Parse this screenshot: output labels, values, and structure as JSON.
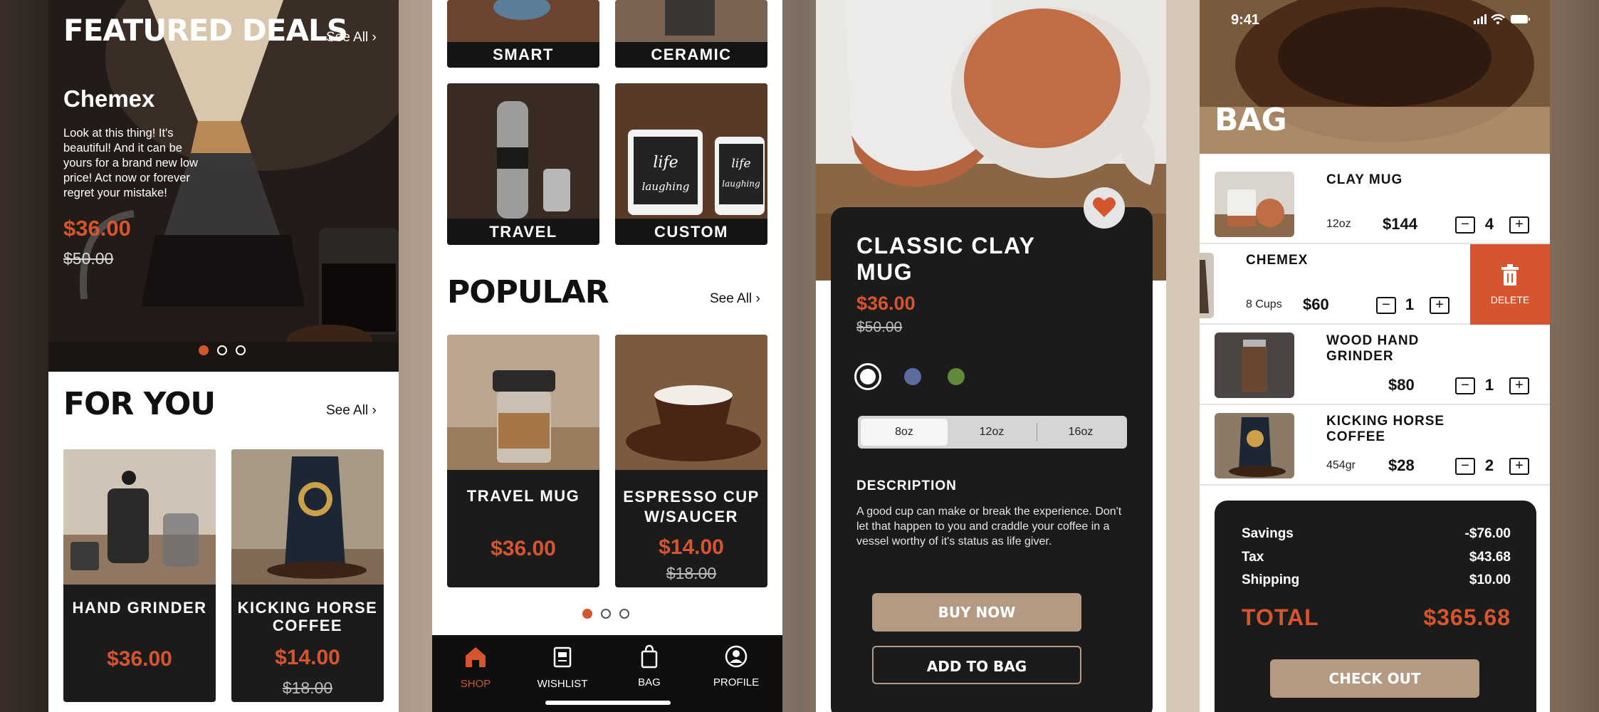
{
  "shop": {
    "featured_title": "FEATURED DEALS",
    "see_all": "See All",
    "hero": {
      "name": "Chemex",
      "description": "Look at this thing! It's beautiful! And it can be yours for a brand new low price! Act now or forever regret your mistake!",
      "price": "$36.00",
      "old_price": "$50.00"
    },
    "for_you_title": "FOR YOU",
    "for_you": [
      {
        "name": "HAND GRINDER",
        "price": "$36.00",
        "old_price": ""
      },
      {
        "name": "KICKING HORSE COFFEE",
        "price": "$14.00",
        "old_price": "$18.00"
      }
    ]
  },
  "categories": {
    "items": [
      "SMART",
      "CERAMIC",
      "TRAVEL",
      "CUSTOM"
    ],
    "popular_title": "POPULAR",
    "see_all": "See All",
    "popular": [
      {
        "name": "TRAVEL MUG",
        "price": "$36.00",
        "old_price": ""
      },
      {
        "name": "ESPRESSO CUP W/SAUCER",
        "price": "$14.00",
        "old_price": "$18.00"
      }
    ],
    "mug_text": "life",
    "mug_subtext": "laughing",
    "nav": [
      {
        "label": "SHOP",
        "icon": "home-icon"
      },
      {
        "label": "WISHLIST",
        "icon": "wishlist-icon"
      },
      {
        "label": "BAG",
        "icon": "bag-icon"
      },
      {
        "label": "PROFILE",
        "icon": "profile-icon"
      }
    ]
  },
  "product": {
    "title": "CLASSIC CLAY MUG",
    "price": "$36.00",
    "old_price": "$50.00",
    "colors": [
      "#ffffff",
      "#5b6d9e",
      "#5e8a3a"
    ],
    "sizes": [
      "8oz",
      "12oz",
      "16oz"
    ],
    "selected_size": "8oz",
    "description_title": "DESCRIPTION",
    "description": "A good cup can make or break the experience. Don't let that happen to you and craddle your coffee in a vessel worthy of it's status as life giver.",
    "buy_now": "BUY NOW",
    "add_to_bag": "ADD TO BAG"
  },
  "bag": {
    "time": "9:41",
    "title": "BAG",
    "items": [
      {
        "name": "CLAY MUG",
        "variant": "12oz",
        "price": "$144",
        "qty": "4"
      },
      {
        "name": "CHEMEX",
        "variant": "8 Cups",
        "price": "$60",
        "qty": "1"
      },
      {
        "name": "WOOD HAND GRINDER",
        "variant": "",
        "price": "$80",
        "qty": "1"
      },
      {
        "name": "KICKING HORSE COFFEE",
        "variant": "454gr",
        "price": "$28",
        "qty": "2"
      }
    ],
    "delete_label": "DELETE",
    "summary": [
      {
        "label": "Savings",
        "value": "-$76.00"
      },
      {
        "label": "Tax",
        "value": "$43.68"
      },
      {
        "label": "Shipping",
        "value": "$10.00"
      }
    ],
    "total_label": "TOTAL",
    "total_value": "$365.68",
    "checkout": "CHECK OUT"
  },
  "colors": {
    "accent": "#d4552e",
    "tan": "#b49a82",
    "dark": "#1b1b1b"
  }
}
